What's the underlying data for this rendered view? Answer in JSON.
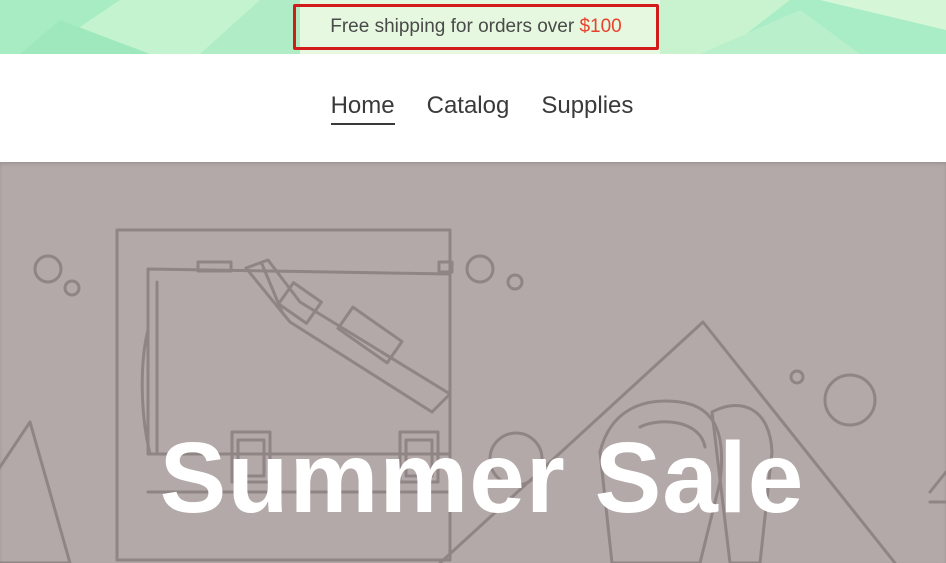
{
  "announcement": {
    "text": "Free shipping for orders over ",
    "price": "$100",
    "colors": {
      "text": "#4a4a4a",
      "price": "#e8422e",
      "highlight_box": "#d21b1b"
    }
  },
  "nav": {
    "items": [
      {
        "label": "Home",
        "active": true
      },
      {
        "label": "Catalog",
        "active": false
      },
      {
        "label": "Supplies",
        "active": false
      }
    ]
  },
  "hero": {
    "title": "Summer Sale",
    "background_color": "#b2a9a8",
    "illustration": "briefcase-and-shapes-outline"
  }
}
